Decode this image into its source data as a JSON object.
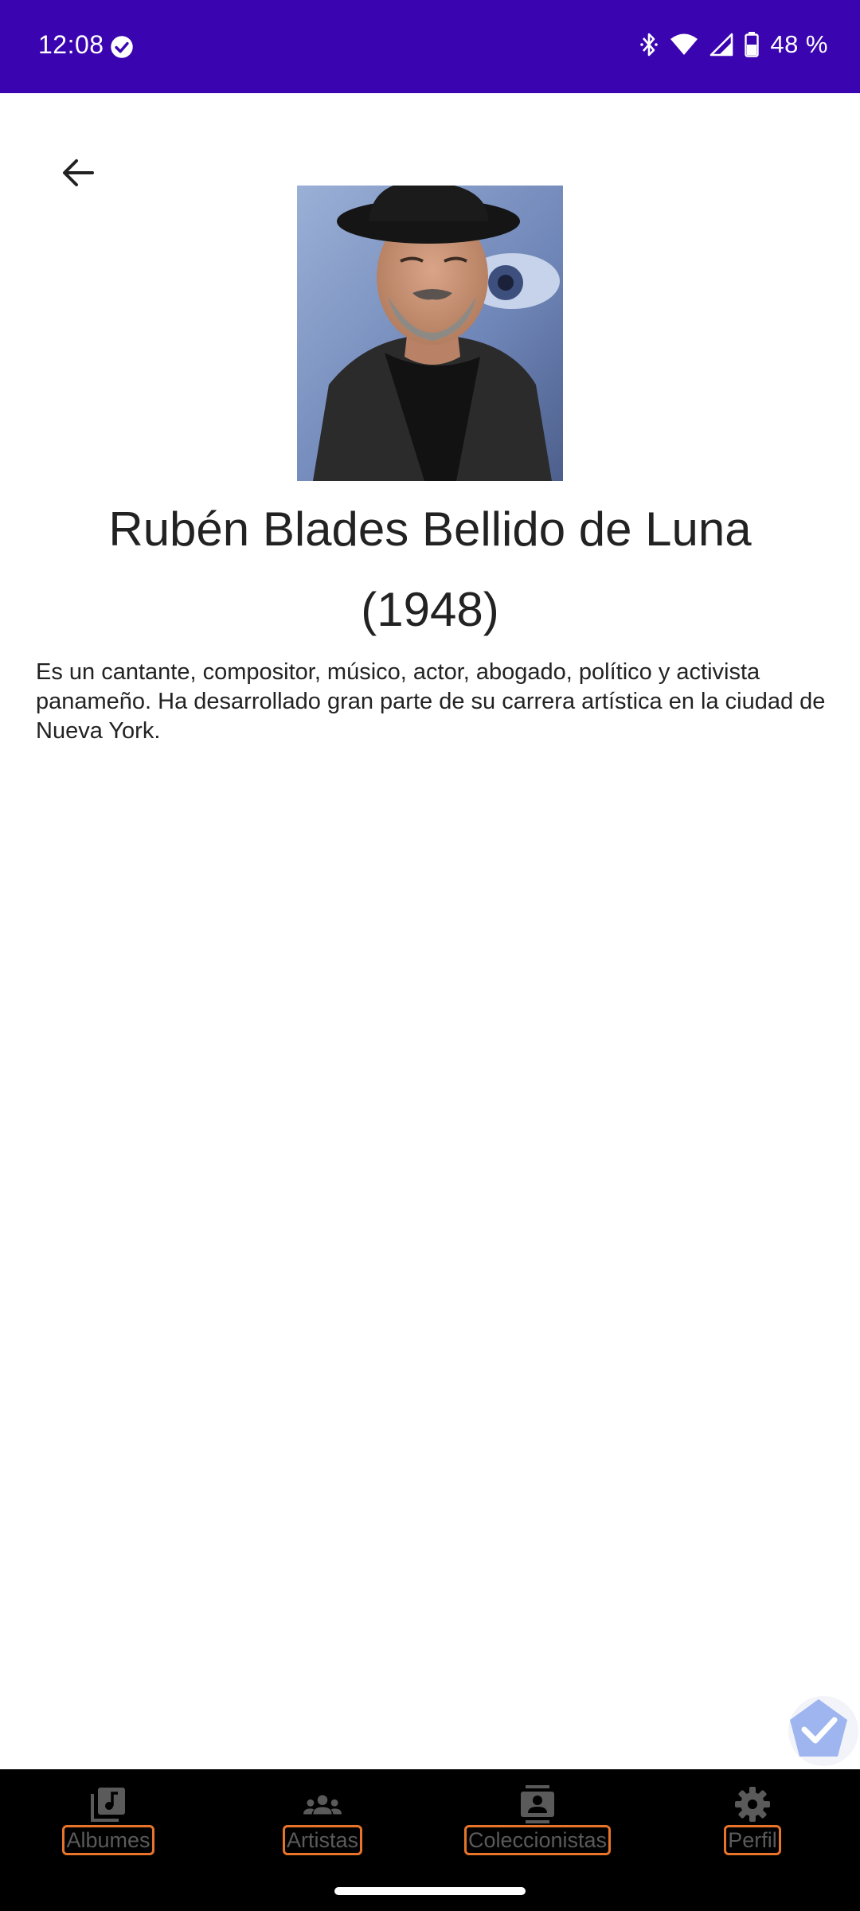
{
  "status_bar": {
    "time": "12:08",
    "battery": "48 %",
    "background_color": "#3a04b0"
  },
  "header": {
    "back_icon": "arrow-left-icon"
  },
  "artist": {
    "photo_icon": "artist-photo",
    "name": "Rubén Blades Bellido de Luna",
    "year": "(1948)",
    "description": "Es un cantante, compositor, músico, actor, abogado, político y activista panameño. Ha desarrollado gran parte de su carrera artística en la ciudad de Nueva York."
  },
  "bottom_nav": {
    "items": [
      {
        "label": "Albumes",
        "icon": "album-icon"
      },
      {
        "label": "Artistas",
        "icon": "people-icon"
      },
      {
        "label": "Coleccionistas",
        "icon": "contact-icon"
      },
      {
        "label": "Perfil",
        "icon": "gear-icon"
      }
    ],
    "highlight_color": "#e8742a"
  }
}
